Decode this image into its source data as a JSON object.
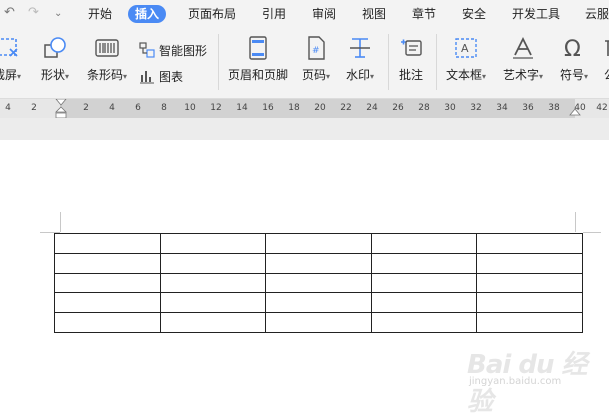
{
  "menubar": {
    "tabs": [
      "开始",
      "插入",
      "页面布局",
      "引用",
      "审阅",
      "视图",
      "章节",
      "安全",
      "开发工具",
      "云服"
    ],
    "active": "插入"
  },
  "ribbon": {
    "screenshot": "截屏",
    "shape": "形状",
    "barcode": "条形码",
    "smartart": "智能图形",
    "chart": "图表",
    "header_footer": "页眉和页脚",
    "page_number": "页码",
    "watermark": "水印",
    "comment": "批注",
    "textbox": "文本框",
    "wordart": "艺术字",
    "symbol": "符号",
    "formula_partial": "公"
  },
  "ruler": {
    "ticks": [
      "4",
      "2",
      "2",
      "4",
      "6",
      "8",
      "10",
      "12",
      "14",
      "16",
      "18",
      "20",
      "22",
      "24",
      "26",
      "28",
      "30",
      "32",
      "34",
      "36",
      "38",
      "40",
      "42"
    ]
  },
  "table": {
    "rows": 5,
    "cols": 5
  },
  "watermark": {
    "logo": "Bai du 经验",
    "sub": "jingyan.baidu.com"
  }
}
